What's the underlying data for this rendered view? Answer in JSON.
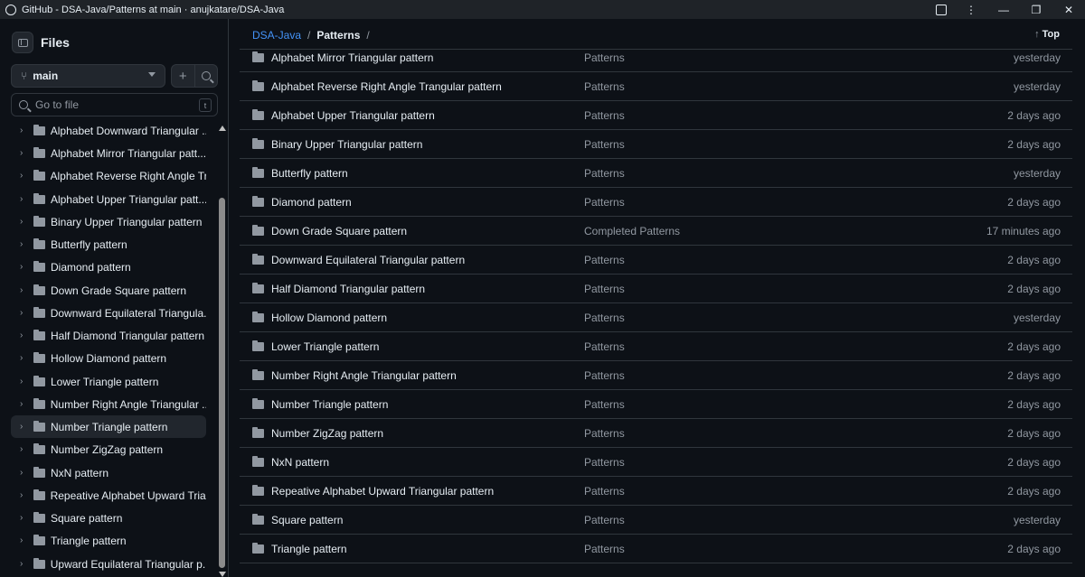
{
  "window": {
    "title": "GitHub - DSA-Java/Patterns at main · anujkatare/DSA-Java"
  },
  "sidebar": {
    "title": "Files",
    "branch": "main",
    "goto_placeholder": "Go to file",
    "goto_shortcut": "t",
    "items": [
      {
        "label": "Alphabet Downward Triangular ..."
      },
      {
        "label": "Alphabet Mirror Triangular patt..."
      },
      {
        "label": "Alphabet Reverse Right Angle Tr..."
      },
      {
        "label": "Alphabet Upper Triangular patt..."
      },
      {
        "label": "Binary Upper Triangular pattern"
      },
      {
        "label": "Butterfly pattern"
      },
      {
        "label": "Diamond pattern"
      },
      {
        "label": "Down Grade Square pattern"
      },
      {
        "label": "Downward Equilateral Triangula..."
      },
      {
        "label": "Half Diamond Triangular pattern"
      },
      {
        "label": "Hollow Diamond pattern"
      },
      {
        "label": "Lower Triangle pattern"
      },
      {
        "label": "Number Right Angle Triangular ..."
      },
      {
        "label": "Number Triangle pattern",
        "selected": true
      },
      {
        "label": "Number ZigZag pattern"
      },
      {
        "label": "NxN pattern"
      },
      {
        "label": "Repeative Alphabet Upward Tria..."
      },
      {
        "label": "Square pattern"
      },
      {
        "label": "Triangle pattern"
      },
      {
        "label": "Upward Equilateral Triangular p..."
      }
    ]
  },
  "breadcrumb": {
    "repo": "DSA-Java",
    "sep": "/",
    "current": "Patterns",
    "trailing": "/"
  },
  "top_link": "Top",
  "rows": [
    {
      "name": "Alphabet Mirror Triangular pattern",
      "commit": "Patterns",
      "age": "yesterday"
    },
    {
      "name": "Alphabet Reverse Right Angle Trangular pattern",
      "commit": "Patterns",
      "age": "yesterday"
    },
    {
      "name": "Alphabet Upper Triangular pattern",
      "commit": "Patterns",
      "age": "2 days ago"
    },
    {
      "name": "Binary Upper Triangular pattern",
      "commit": "Patterns",
      "age": "2 days ago"
    },
    {
      "name": "Butterfly pattern",
      "commit": "Patterns",
      "age": "yesterday"
    },
    {
      "name": "Diamond pattern",
      "commit": "Patterns",
      "age": "2 days ago"
    },
    {
      "name": "Down Grade Square pattern",
      "commit": "Completed Patterns",
      "age": "17 minutes ago"
    },
    {
      "name": "Downward Equilateral Triangular pattern",
      "commit": "Patterns",
      "age": "2 days ago"
    },
    {
      "name": "Half Diamond Triangular pattern",
      "commit": "Patterns",
      "age": "2 days ago"
    },
    {
      "name": "Hollow Diamond pattern",
      "commit": "Patterns",
      "age": "yesterday"
    },
    {
      "name": "Lower Triangle pattern",
      "commit": "Patterns",
      "age": "2 days ago"
    },
    {
      "name": "Number Right Angle Triangular pattern",
      "commit": "Patterns",
      "age": "2 days ago"
    },
    {
      "name": "Number Triangle pattern",
      "commit": "Patterns",
      "age": "2 days ago"
    },
    {
      "name": "Number ZigZag pattern",
      "commit": "Patterns",
      "age": "2 days ago"
    },
    {
      "name": "NxN pattern",
      "commit": "Patterns",
      "age": "2 days ago"
    },
    {
      "name": "Repeative Alphabet Upward Triangular pattern",
      "commit": "Patterns",
      "age": "2 days ago"
    },
    {
      "name": "Square pattern",
      "commit": "Patterns",
      "age": "yesterday"
    },
    {
      "name": "Triangle pattern",
      "commit": "Patterns",
      "age": "2 days ago"
    }
  ]
}
